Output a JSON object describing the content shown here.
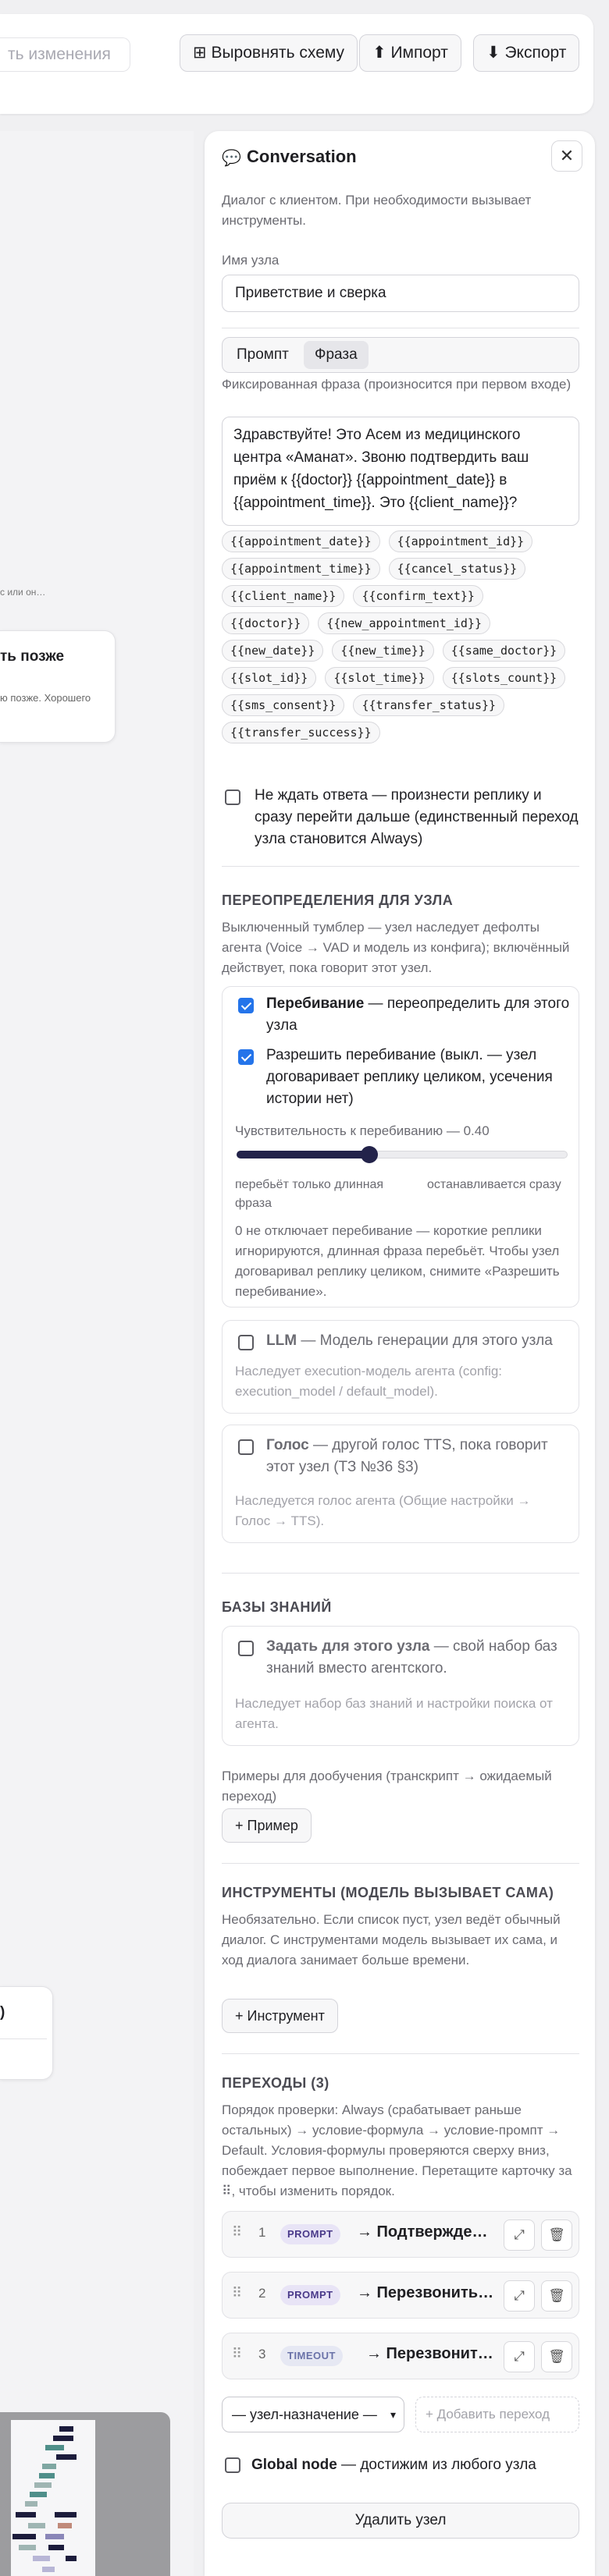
{
  "toolbar": {
    "save_hint": "ть изменения",
    "align_label": "Выровнять схему",
    "import_label": "Импорт",
    "export_label": "Экспорт"
  },
  "canvas": {
    "hint": "с или он…",
    "node1_title": "ть позже",
    "node1_desc": "ю позже. Хорошего",
    "node2_title": ")"
  },
  "panel": {
    "title": "Conversation",
    "description": "Диалог с клиентом. При необходимости вызывает инструменты.",
    "name_label": "Имя узла",
    "name_value": "Приветствие и сверка",
    "mode_prompt": "Промпт",
    "mode_phrase": "Фраза",
    "phrase_label": "Фиксированная фраза (произносится при первом входе)",
    "phrase_text": "Здравствуйте! Это Асем из медицинского центра «Аманат». Звоню подтвердить ваш приём к {{doctor}} {{appointment_date}} в {{appointment_time}}. Это {{client_name}}?",
    "variables": [
      "{{appointment_date}}",
      "{{appointment_id}}",
      "{{appointment_time}}",
      "{{cancel_status}}",
      "{{client_name}}",
      "{{confirm_text}}",
      "{{doctor}}",
      "{{new_appointment_id}}",
      "{{new_date}}",
      "{{new_time}}",
      "{{same_doctor}}",
      "{{slot_id}}",
      "{{slot_time}}",
      "{{slots_count}}",
      "{{sms_consent}}",
      "{{transfer_status}}",
      "{{transfer_success}}"
    ],
    "no_wait_label": "Не ждать ответа — произнести реплику и сразу перейти дальше (единственный переход узла становится Always)",
    "no_wait_checked": false
  },
  "overrides": {
    "heading": "ПЕРЕОПРЕДЕЛЕНИЯ ДЛЯ УЗЛА",
    "description": "Выключенный тумблер — узел наследует дефолты агента (Voice → VAD и модель из конфига); включённый действует, пока говорит этот узел.",
    "interrupt": {
      "bold": "Перебивание",
      "rest": " — переопределить для этого узла",
      "checked": true,
      "allow_label": "Разрешить перебивание (выкл. — узел договаривает реплику целиком, усечения истории нет)",
      "allow_checked": true,
      "sensitivity_label": "Чувствительность к перебиванию — 0.40",
      "sensitivity_value": 0.4,
      "left_hint": "перебьёт только длинная фраза",
      "right_hint": "останавливается сразу",
      "note": "0 не отключает перебивание — короткие реплики игнорируются, длинная фраза перебьёт. Чтобы узел договаривал реплику целиком, снимите «Разрешить перебивание»."
    },
    "llm": {
      "bold": "LLM",
      "rest": " — Модель генерации для этого узла",
      "checked": false,
      "note": "Наследует execution-модель агента (config: execution_model / default_model)."
    },
    "voice": {
      "bold": "Голос",
      "rest": " — другой голос TTS, пока говорит этот узел (ТЗ №36 §3)",
      "checked": false,
      "note": "Наследуется голос агента (Общие настройки → Голос → TTS)."
    }
  },
  "kb": {
    "heading": "БАЗЫ ЗНАНИЙ",
    "bold": "Задать для этого узла",
    "rest": " — свой набор баз знаний вместо агентского.",
    "checked": false,
    "note": "Наследует набор баз знаний и настройки поиска от агента.",
    "examples_label": "Примеры для дообучения (транскрипт → ожидаемый переход)",
    "add_example": "+ Пример"
  },
  "tools": {
    "heading": "ИНСТРУМЕНТЫ (МОДЕЛЬ ВЫЗЫВАЕТ САМА)",
    "description": "Необязательно. Если список пуст, узел ведёт обычный диалог. С инструментами модель вызывает их сама, и ход диалога занимает больше времени.",
    "add_tool": "+ Инструмент"
  },
  "transitions": {
    "heading": "ПЕРЕХОДЫ (3)",
    "description": "Порядок проверки: Always (срабатывает раньше остальных) → условие-формула → условие-промпт → Default. Условия-формулы проверяются сверху вниз, побеждает первое выполнение. Перетащите карточку за ⠿, чтобы изменить порядок.",
    "items": [
      {
        "num": "1",
        "type": "PROMPT",
        "target": "→ Подтверждение записи"
      },
      {
        "num": "2",
        "type": "PROMPT",
        "target": "→ Перезвонить позже"
      },
      {
        "num": "3",
        "type": "TIMEOUT",
        "target": "→ Перезвонить позже"
      }
    ],
    "target_select": "— узел-назначение —",
    "add_transition": "+ Добавить переход",
    "global_bold": "Global node",
    "global_rest": " — достижим из любого узла",
    "global_checked": false,
    "delete_node": "Удалить узел"
  },
  "colors": {
    "accent": "#2474ea",
    "slider": "#23234a",
    "prompt_badge_bg": "#e8e4f6",
    "prompt_badge_fg": "#4a3a8a",
    "timeout_badge_bg": "#e6e8f3",
    "timeout_badge_fg": "#6a72a8"
  }
}
